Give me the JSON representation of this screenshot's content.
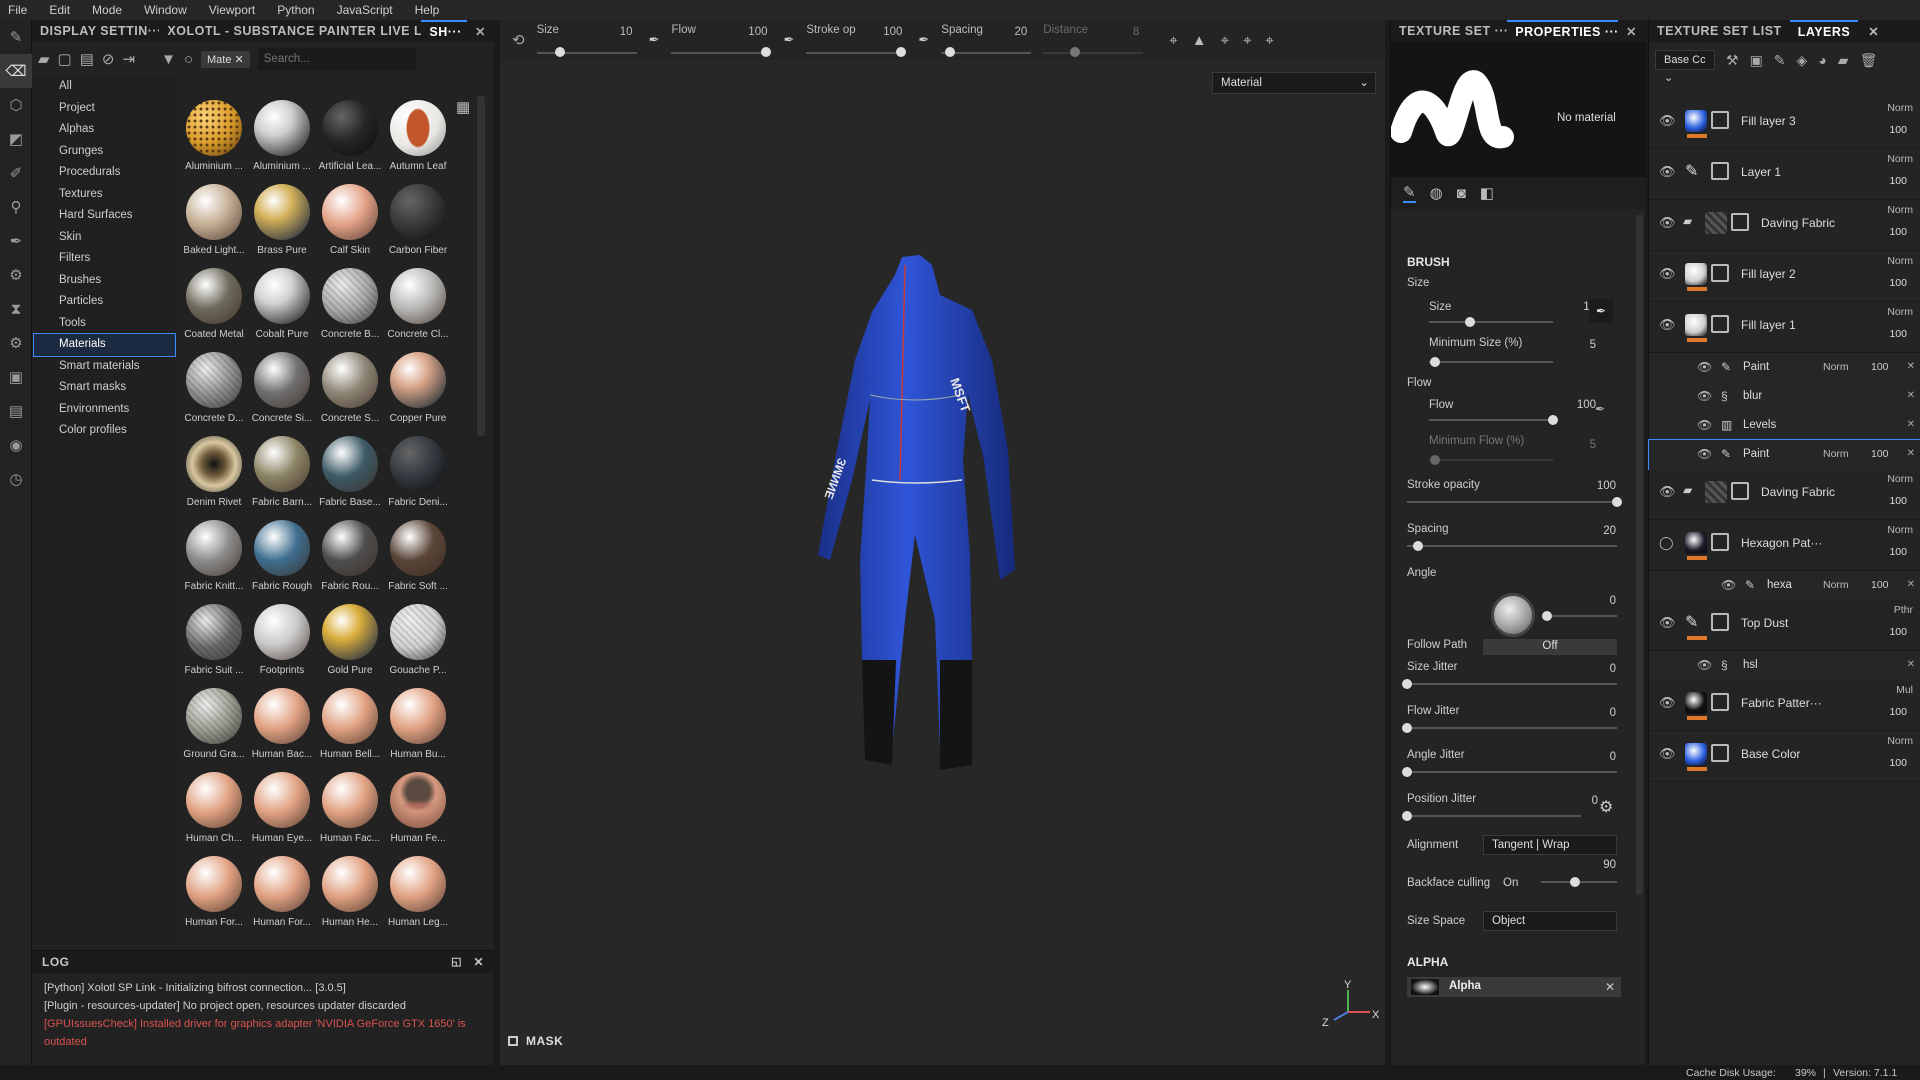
{
  "menu": [
    "File",
    "Edit",
    "Mode",
    "Window",
    "Viewport",
    "Python",
    "JavaScript",
    "Help"
  ],
  "shelf": {
    "tabs": [
      "DISPLAY SETTIN···",
      "XOLOTL - SUBSTANCE PAINTER LIVE L···",
      "SH···"
    ],
    "filter_chip": "Mate",
    "search_placeholder": "Search...",
    "categories": [
      "All",
      "Project",
      "Alphas",
      "Grunges",
      "Procedurals",
      "Textures",
      "Hard Surfaces",
      "Skin",
      "Filters",
      "Brushes",
      "Particles",
      "Tools",
      "Materials",
      "Smart materials",
      "Smart masks",
      "Environments",
      "Color profiles"
    ],
    "selected_category": "Materials",
    "materials": [
      {
        "label": "Aluminium ...",
        "color": "#d89a2a",
        "pattern": "dots"
      },
      {
        "label": "Aluminium ...",
        "color": "#cfcfcf",
        "pattern": "metal"
      },
      {
        "label": "Artificial Lea...",
        "color": "#262626",
        "pattern": "dark"
      },
      {
        "label": "Autumn Leaf",
        "color": "#e8e6e2",
        "pattern": "leaf"
      },
      {
        "label": "Baked Light...",
        "color": "#c5ae94",
        "pattern": "flat"
      },
      {
        "label": "Brass Pure",
        "color": "#d4b25a",
        "pattern": "metal"
      },
      {
        "label": "Calf Skin",
        "color": "#e3a186",
        "pattern": "flat"
      },
      {
        "label": "Carbon Fiber",
        "color": "#3a3a3a",
        "pattern": "dark"
      },
      {
        "label": "Coated Metal",
        "color": "#6e6a5c",
        "pattern": "flat"
      },
      {
        "label": "Cobalt Pure",
        "color": "#d2d2d2",
        "pattern": "metal"
      },
      {
        "label": "Concrete B...",
        "color": "#a8a8a6",
        "pattern": "noise"
      },
      {
        "label": "Concrete Cl...",
        "color": "#b8b8b6",
        "pattern": "flat"
      },
      {
        "label": "Concrete D...",
        "color": "#8f8f8d",
        "pattern": "noise"
      },
      {
        "label": "Concrete Si...",
        "color": "#707070",
        "pattern": "flat"
      },
      {
        "label": "Concrete S...",
        "color": "#8e8676",
        "pattern": "flat"
      },
      {
        "label": "Copper Pure",
        "color": "#d9a58a",
        "pattern": "metal"
      },
      {
        "label": "Denim Rivet",
        "color": "#6d5a3a",
        "pattern": "rivet"
      },
      {
        "label": "Fabric Barn...",
        "color": "#8b8465",
        "pattern": "flat"
      },
      {
        "label": "Fabric Base...",
        "color": "#3c5a66",
        "pattern": "flat"
      },
      {
        "label": "Fabric Deni...",
        "color": "#333a40",
        "pattern": "dark"
      },
      {
        "label": "Fabric Knitt...",
        "color": "#8c8c8c",
        "pattern": "flat"
      },
      {
        "label": "Fabric Rough",
        "color": "#3e6e8e",
        "pattern": "flat"
      },
      {
        "label": "Fabric Rou...",
        "color": "#4e4e4e",
        "pattern": "flat"
      },
      {
        "label": "Fabric Soft ...",
        "color": "#5a4538",
        "pattern": "flat"
      },
      {
        "label": "Fabric Suit ...",
        "color": "#6a6a6a",
        "pattern": "noise"
      },
      {
        "label": "Footprints",
        "color": "#c9c9c9",
        "pattern": "flat"
      },
      {
        "label": "Gold Pure",
        "color": "#d9ae3c",
        "pattern": "metal"
      },
      {
        "label": "Gouache P...",
        "color": "#d2d2d2",
        "pattern": "noise"
      },
      {
        "label": "Ground Gra...",
        "color": "#9b9a8e",
        "pattern": "noise"
      },
      {
        "label": "Human Bac...",
        "color": "#e1a283",
        "pattern": "flat"
      },
      {
        "label": "Human Bell...",
        "color": "#e1a283",
        "pattern": "flat"
      },
      {
        "label": "Human Bu...",
        "color": "#e1a283",
        "pattern": "flat"
      },
      {
        "label": "Human Ch...",
        "color": "#e1a283",
        "pattern": "flat"
      },
      {
        "label": "Human Eye...",
        "color": "#e1a283",
        "pattern": "flat"
      },
      {
        "label": "Human Fac...",
        "color": "#e1a283",
        "pattern": "flat"
      },
      {
        "label": "Human Fe...",
        "color": "#d69a80",
        "pattern": "face"
      },
      {
        "label": "Human For...",
        "color": "#e1a283",
        "pattern": "flat"
      },
      {
        "label": "Human For...",
        "color": "#e1a283",
        "pattern": "flat"
      },
      {
        "label": "Human He...",
        "color": "#e1a283",
        "pattern": "flat"
      },
      {
        "label": "Human Leg...",
        "color": "#e1a283",
        "pattern": "flat"
      }
    ]
  },
  "log": {
    "title": "LOG",
    "lines": [
      {
        "text": "[Python] Xolotl SP Link - Initializing bifrost connection... [3.0.5]",
        "color": "#cfcfcf"
      },
      {
        "text": "[Plugin - resources-updater] No project open, resources updater discarded",
        "color": "#cfcfcf"
      },
      {
        "text": "[GPUIssuesCheck] Installed driver for graphics adapter 'NVIDIA GeForce GTX 1650' is",
        "color": "#d9534f"
      },
      {
        "text": "outdated",
        "color": "#d9534f"
      }
    ]
  },
  "toolbar": {
    "sliders": [
      {
        "label": "Size",
        "value": "10",
        "pos": 0.2
      },
      {
        "label": "Flow",
        "value": "100",
        "pos": 1.0
      },
      {
        "label": "Stroke op",
        "value": "100",
        "pos": 1.0
      },
      {
        "label": "Spacing",
        "value": "20",
        "pos": 0.05
      },
      {
        "label": "Distance",
        "value": "8",
        "pos": 0.3
      }
    ]
  },
  "viewport": {
    "material_select": "Material",
    "mask_label": "MASK",
    "axis_labels": [
      "Y",
      "Z",
      "X"
    ]
  },
  "props": {
    "tabs": [
      "TEXTURE SET ···",
      "PROPERTIES ···"
    ],
    "no_material": "No material",
    "section_brush": "BRUSH",
    "size_header": "Size",
    "size_label": "Size",
    "size_value": "10",
    "min_size_label": "Minimum Size (%)",
    "min_size_value": "5",
    "flow_header": "Flow",
    "flow_label": "Flow",
    "flow_value": "100",
    "min_flow_label": "Minimum Flow (%)",
    "min_flow_value": "5",
    "stroke_label": "Stroke opacity",
    "stroke_value": "100",
    "spacing_label": "Spacing",
    "spacing_value": "20",
    "angle_label": "Angle",
    "angle_value": "0",
    "follow_label": "Follow Path",
    "follow_value": "Off",
    "size_jitter_label": "Size Jitter",
    "size_jitter_value": "0",
    "flow_jitter_label": "Flow Jitter",
    "flow_jitter_value": "0",
    "angle_jitter_label": "Angle Jitter",
    "angle_jitter_value": "0",
    "pos_jitter_label": "Position Jitter",
    "pos_jitter_value": "0",
    "alignment_label": "Alignment",
    "alignment_value": "Tangent | Wrap",
    "backface_label": "Backface culling",
    "backface_on": "On",
    "backface_value": "90",
    "size_space_label": "Size Space",
    "size_space_value": "Object",
    "alpha_header": "ALPHA",
    "alpha_value": "Alpha"
  },
  "layers_panel": {
    "tabs": [
      "TEXTURE SET LIST",
      "LAYERS"
    ],
    "base_select": "Base Cc",
    "items": [
      {
        "name": "Fill layer 3",
        "blend": "Norm",
        "opacity": "100",
        "type": "fill",
        "color": "#2a5fe0"
      },
      {
        "name": "Layer 1",
        "blend": "Norm",
        "opacity": "100",
        "type": "paint",
        "color": ""
      },
      {
        "name": "Daving Fabric",
        "blend": "Norm",
        "opacity": "100",
        "type": "folder",
        "color": ""
      },
      {
        "name": "Fill layer 2",
        "blend": "Norm",
        "opacity": "100",
        "type": "fill",
        "color": "#d0d0d0"
      },
      {
        "name": "Fill layer 1",
        "blend": "Norm",
        "opacity": "100",
        "type": "fill",
        "color": "#d0d0d0"
      },
      {
        "name": "Daving Fabric",
        "blend": "Norm",
        "opacity": "100",
        "type": "folder",
        "color": ""
      },
      {
        "name": "Hexagon Pat···",
        "blend": "Norm",
        "opacity": "100",
        "type": "fill",
        "color": "#1a1a2a"
      },
      {
        "name": "Top Dust",
        "blend": "Pthr",
        "opacity": "100",
        "type": "paint",
        "color": ""
      },
      {
        "name": "Fabric Patter···",
        "blend": "Mul",
        "opacity": "100",
        "type": "fill",
        "color": "#111"
      },
      {
        "name": "Base Color",
        "blend": "Norm",
        "opacity": "100",
        "type": "fill",
        "color": "#2a5fe0"
      }
    ],
    "effects": [
      {
        "name": "Paint",
        "blend": "Norm",
        "opacity": "100"
      },
      {
        "name": "blur",
        "blend": "",
        "opacity": ""
      },
      {
        "name": "Levels",
        "blend": "",
        "opacity": ""
      },
      {
        "name": "Paint",
        "blend": "Norm",
        "opacity": "100"
      },
      {
        "name": "hexa",
        "blend": "Norm",
        "opacity": "100"
      },
      {
        "name": "hsl",
        "blend": "",
        "opacity": ""
      }
    ]
  },
  "status": {
    "cache": "Cache Disk Usage:",
    "cache_value": "39%",
    "version": "Version: 7.1.1"
  }
}
